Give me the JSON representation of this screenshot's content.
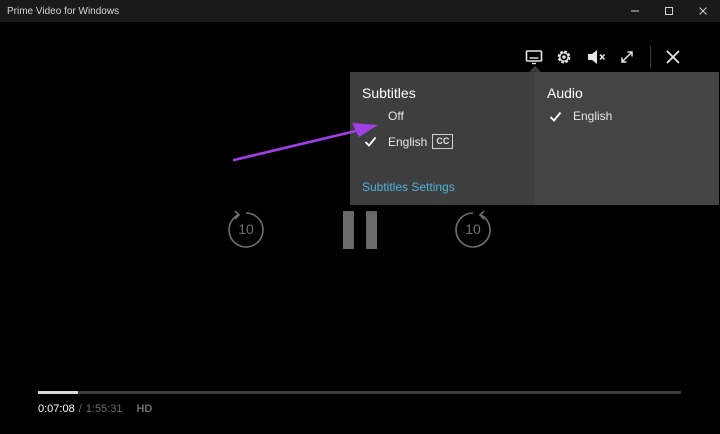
{
  "window": {
    "title": "Prime Video for Windows",
    "controls": [
      "minimize",
      "maximize",
      "close"
    ]
  },
  "player": {
    "top_controls": {
      "icons": [
        "subtitles-icon",
        "settings-gear-icon",
        "mute-icon",
        "fullscreen-icon",
        "close-icon"
      ]
    },
    "center_controls": {
      "rewind_label": "10",
      "forward_label": "10"
    },
    "menu": {
      "subtitles": {
        "heading": "Subtitles",
        "options": [
          {
            "label": "Off",
            "selected": false
          },
          {
            "label": "English",
            "selected": true,
            "badge": "CC"
          }
        ],
        "settings_link": "Subtitles Settings"
      },
      "audio": {
        "heading": "Audio",
        "options": [
          {
            "label": "English",
            "selected": true
          }
        ]
      }
    },
    "playback": {
      "current_time": "0:07:08",
      "separator": "/",
      "total_time": "1:55:31",
      "quality": "HD",
      "progress_fraction": 0.062
    }
  },
  "colors": {
    "annotation_arrow": "#a23ee6",
    "link": "#4fb3d9",
    "menu_bg": "#3e3e3e"
  }
}
